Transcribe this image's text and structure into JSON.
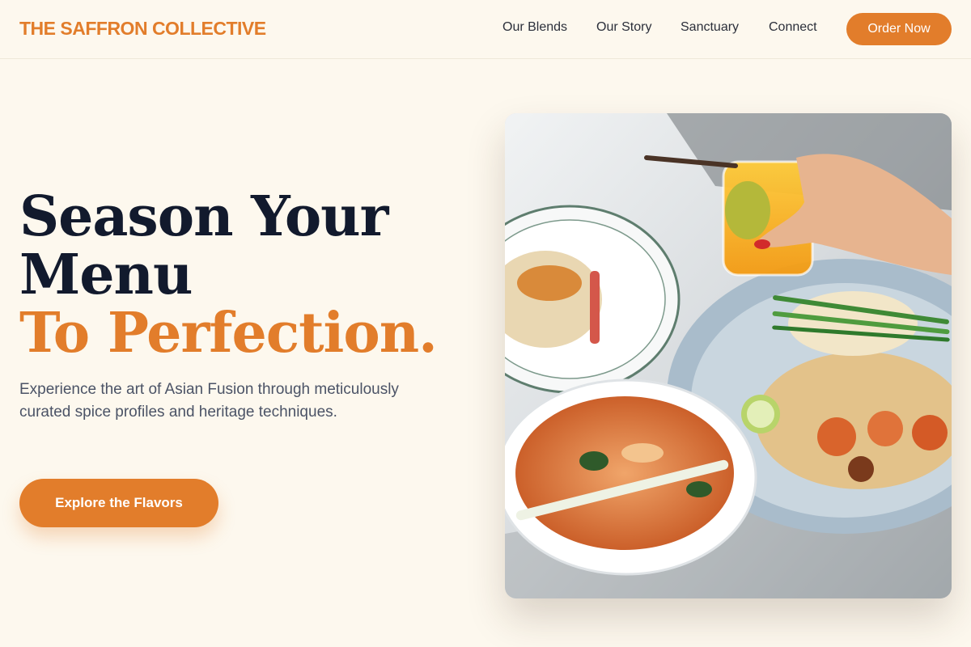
{
  "header": {
    "brand": "THE SAFFRON COLLECTIVE",
    "nav": [
      "Our Blends",
      "Our Story",
      "Sanctuary",
      "Connect"
    ],
    "order_button": "Order Now"
  },
  "hero": {
    "headline_line1": "Season Your",
    "headline_line2": "Menu",
    "headline_accent": "To Perfection.",
    "description": "Experience the art of Asian Fusion through meticulously curated spice profiles and heritage techniques.",
    "cta_label": "Explore the Flavors",
    "image_subject": "asian-fusion-dishes-photo"
  },
  "colors": {
    "accent": "#e27d2b",
    "background": "#fdf8ee",
    "heading": "#121a2d",
    "body_text": "#4b5366"
  }
}
